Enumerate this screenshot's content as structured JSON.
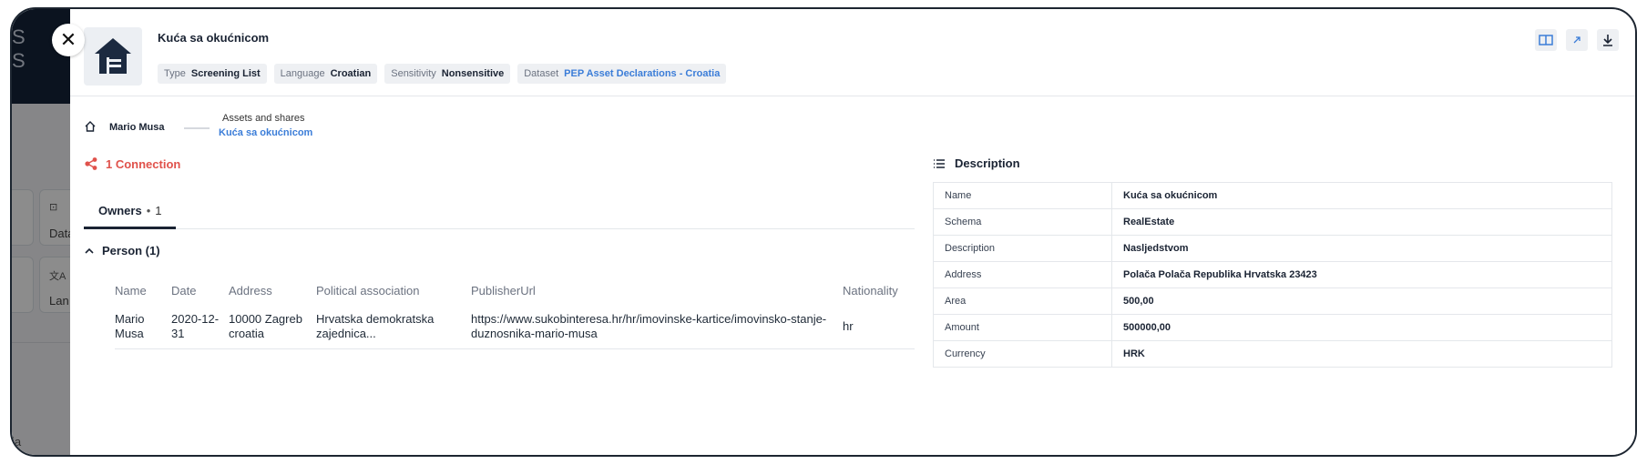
{
  "background": {
    "logo_lines": [
      "S",
      "S"
    ],
    "cards": [
      {
        "icon": "dataset-icon",
        "label": "Data"
      },
      {
        "icon": "translate-icon",
        "label": "Lan"
      }
    ],
    "footer_text": "ia"
  },
  "entity": {
    "title": "Kuća sa okućnicom",
    "icon": "house-icon",
    "tags": [
      {
        "key": "Type",
        "value": "Screening List"
      },
      {
        "key": "Language",
        "value": "Croatian"
      },
      {
        "key": "Sensitivity",
        "value": "Nonsensitive"
      },
      {
        "key": "Dataset",
        "value": "PEP Asset Declarations - Croatia"
      }
    ],
    "actions": [
      "book-icon",
      "external-link-icon",
      "download-icon"
    ]
  },
  "breadcrumb": {
    "root": "Mario Musa",
    "section": "Assets and shares",
    "current": "Kuća sa okućnicom"
  },
  "connections": {
    "label": "1 Connection",
    "tab_label": "Owners",
    "tab_count": "1",
    "group_label": "Person (1)",
    "columns": [
      "Name",
      "Date",
      "Address",
      "Political association",
      "PublisherUrl",
      "Nationality"
    ],
    "rows": [
      {
        "name": "Mario Musa",
        "date": "2020-12-31",
        "address": "10000 Zagreb croatia",
        "political": "Hrvatska demokratska zajednica...",
        "url": "https://www.sukobinteresa.hr/hr/imovinske-kartice/imovinsko-stanje-duznosnika-mario-musa",
        "nationality": "hr"
      }
    ]
  },
  "description": {
    "title": "Description",
    "rows": [
      {
        "key": "Name",
        "value": "Kuća sa okućnicom"
      },
      {
        "key": "Schema",
        "value": "RealEstate"
      },
      {
        "key": "Description",
        "value": "Nasljedstvom"
      },
      {
        "key": "Address",
        "value": "Polača Polača Republika Hrvatska 23423"
      },
      {
        "key": "Area",
        "value": "500,00"
      },
      {
        "key": "Amount",
        "value": "500000,00"
      },
      {
        "key": "Currency",
        "value": "HRK"
      }
    ]
  },
  "colors": {
    "accent_link": "#3b7dd8",
    "connection_red": "#e0524b",
    "header_dark": "#14233a"
  }
}
